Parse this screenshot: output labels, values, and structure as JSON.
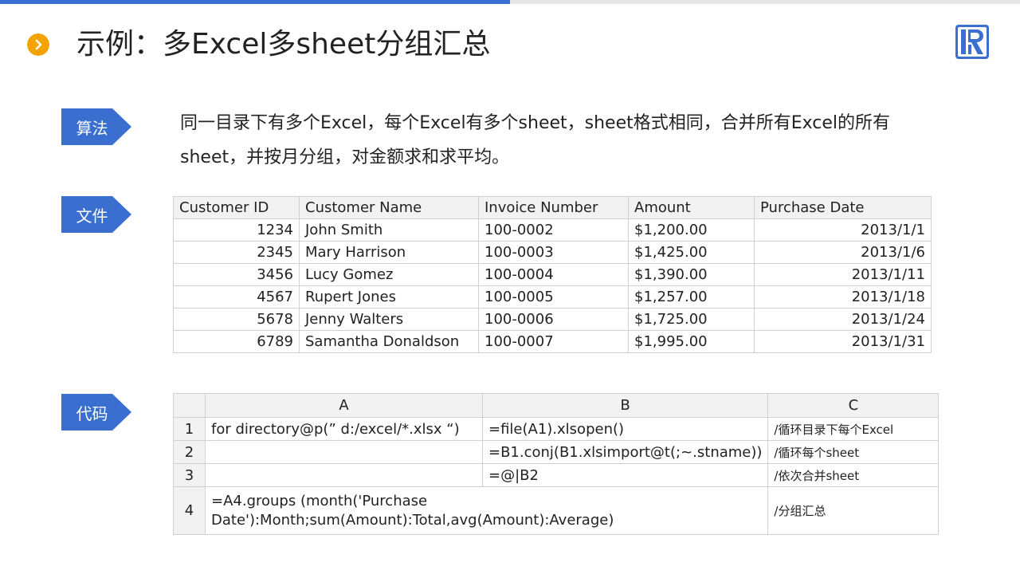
{
  "page": {
    "title": "示例：多Excel多sheet分组汇总"
  },
  "colors": {
    "accent_blue": "#3a6fd0",
    "bullet_orange": "#f5a300"
  },
  "icons": {
    "title_bullet": "chevron-right-icon",
    "logo": "r-logo-icon"
  },
  "sections": {
    "algorithm": {
      "tag": "算法",
      "text": "同一目录下有多个Excel，每个Excel有多个sheet，sheet格式相同，合并所有Excel的所有sheet，并按月分组，对金额求和求平均。"
    },
    "files": {
      "tag": "文件",
      "headers": [
        "Customer ID",
        "Customer Name",
        "Invoice Number",
        "Amount",
        "Purchase Date"
      ],
      "rows": [
        [
          "1234",
          "John Smith",
          "100-0002",
          "$1,200.00",
          "2013/1/1"
        ],
        [
          "2345",
          "Mary Harrison",
          "100-0003",
          "$1,425.00",
          "2013/1/6"
        ],
        [
          "3456",
          "Lucy Gomez",
          "100-0004",
          "$1,390.00",
          "2013/1/11"
        ],
        [
          "4567",
          "Rupert Jones",
          "100-0005",
          "$1,257.00",
          "2013/1/18"
        ],
        [
          "5678",
          "Jenny Walters",
          "100-0006",
          "$1,725.00",
          "2013/1/24"
        ],
        [
          "6789",
          "Samantha Donaldson",
          "100-0007",
          "$1,995.00",
          "2013/1/31"
        ]
      ]
    },
    "code": {
      "tag": "代码",
      "headers": [
        "",
        "A",
        "B",
        "C"
      ],
      "rows": [
        [
          "1",
          "for directory@p(” d:/excel/*.xlsx “)",
          "=file(A1).xlsopen()",
          "/循环目录下每个Excel"
        ],
        [
          "2",
          "",
          "=B1.conj(B1.xlsimport@t(;~.stname))",
          "/循环每个sheet"
        ],
        [
          "3",
          "",
          "=@|B2",
          "/依次合并sheet"
        ],
        [
          "4",
          "=A4.groups (month('Purchase Date'):Month;sum(Amount):Total,avg(Amount):Average)",
          "",
          "/分组汇总"
        ]
      ]
    }
  }
}
